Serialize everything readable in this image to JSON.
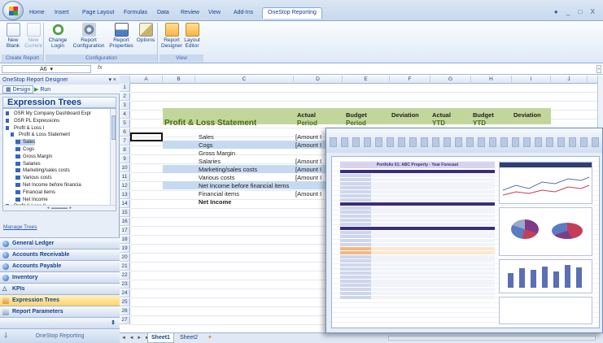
{
  "ribbon_tabs": [
    "Home",
    "Insert",
    "Page Layout",
    "Formulas",
    "Data",
    "Review",
    "View",
    "Add-Ins",
    "OneStop Reporting"
  ],
  "window_controls": "● _ □ X",
  "ribbon": {
    "groups": [
      {
        "label": "Create Report",
        "buttons": [
          {
            "label": "New Blank",
            "disabled": false
          },
          {
            "label": "New Current",
            "disabled": true
          }
        ]
      },
      {
        "label": "Configuration",
        "buttons": [
          {
            "label": "Change Login"
          },
          {
            "label": "Report Configuration"
          },
          {
            "label": "Report Properties"
          },
          {
            "label": "Options"
          }
        ]
      },
      {
        "label": "View",
        "buttons": [
          {
            "label": "Report Designer"
          },
          {
            "label": "Layout Editor"
          }
        ]
      }
    ]
  },
  "formula_bar": {
    "name_box": "A6",
    "fx": "fx",
    "expand": "»"
  },
  "pane": {
    "title": "OneStop Report Designer",
    "close": "▾ ×",
    "toolbar": [
      "Design",
      "Run"
    ],
    "section_title": "Expression Trees",
    "tree": [
      {
        "label": "OSR My Company Dashboard Expr",
        "level": 0
      },
      {
        "label": "OSR PL Expressions",
        "level": 0
      },
      {
        "label": "Profit & Loss I",
        "level": 0
      },
      {
        "label": "Profit & Loss Statement",
        "level": 1
      },
      {
        "label": "Sales",
        "level": 2
      },
      {
        "label": "Cogs",
        "level": 2
      },
      {
        "label": "Gross Margin",
        "level": 2
      },
      {
        "label": "Salaries",
        "level": 2
      },
      {
        "label": "Marketing/sales costs",
        "level": 2
      },
      {
        "label": "Various costs",
        "level": 2
      },
      {
        "label": "Net Income before financia",
        "level": 2
      },
      {
        "label": "Financial items",
        "level": 2
      },
      {
        "label": "Net Income",
        "level": 2
      },
      {
        "label": "Profit & Loss II",
        "level": 0
      }
    ],
    "manage_link": "Manage Trees",
    "nav": [
      "General Ledger",
      "Accounts Receivable",
      "Accounts Payable",
      "Inventory",
      "KPIs",
      "Expression Trees",
      "Report Parameters"
    ],
    "active_nav": "Expression Trees",
    "footer": "OneStop Reporting"
  },
  "sheet": {
    "columns": [
      "A",
      "B",
      "C",
      "D",
      "E",
      "F",
      "G",
      "H",
      "I",
      "J"
    ],
    "rows": [
      "1",
      "2",
      "3",
      "4",
      "5",
      "6",
      "7",
      "8",
      "9",
      "10",
      "11",
      "12",
      "13",
      "14",
      "15",
      "16",
      "17",
      "18",
      "19",
      "20",
      "21",
      "22",
      "23",
      "24",
      "25",
      "26",
      "27"
    ],
    "header_row4": [
      "Actual",
      "Budget",
      "Deviation",
      "Actual",
      "Budget",
      "Deviation"
    ],
    "header_row5": [
      "Period",
      "Period",
      "",
      "YTD",
      "YTD",
      ""
    ],
    "statement_title": "Profit & Loss Statement",
    "line_items": [
      "Sales",
      "Cogs",
      "Gross Margin",
      "Salaries",
      "Marketing/sales costs",
      "Various costs",
      "Net Income before financial items",
      "Financial items",
      "Net Income"
    ],
    "amount_placeholder": "[Amount I",
    "tabs": [
      "Sheet1",
      "Sheet2"
    ],
    "nav_arrows": "◄ ◄ ► ►",
    "colors": {
      "header_band": "#c2d69b",
      "highlight_band": "#c5d9f1",
      "accent_text": "#4a6d17"
    }
  },
  "overlay": {
    "title": "Portfolio 01: ABC Property - Year Forecast"
  }
}
